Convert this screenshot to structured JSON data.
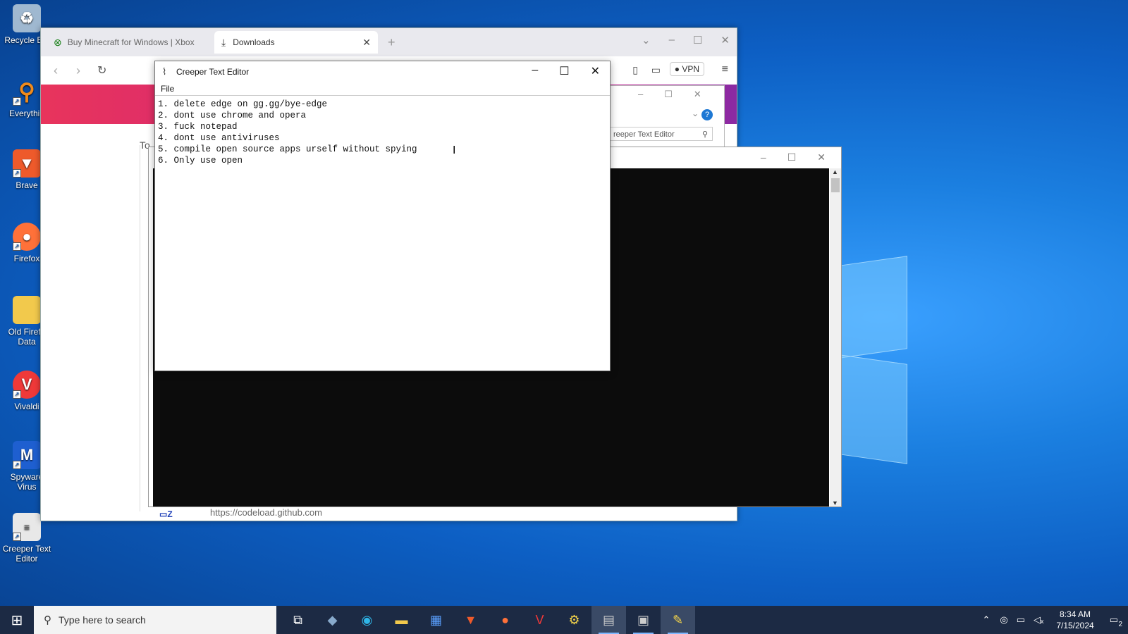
{
  "desktop": {
    "icons": [
      {
        "label": "Recycle Bin",
        "icon": "recycle-bin-icon",
        "color": "#9fb8d0"
      },
      {
        "label": "Everythin",
        "icon": "everything-icon",
        "color": "#f08a1c"
      },
      {
        "label": "Brave",
        "icon": "brave-icon",
        "color": "#ee5a2b"
      },
      {
        "label": "Firefox",
        "icon": "firefox-icon",
        "color": "#ff7139"
      },
      {
        "label": "Old Firefo Data",
        "icon": "folder-icon",
        "color": "#f2c94c"
      },
      {
        "label": "Vivaldi",
        "icon": "vivaldi-icon",
        "color": "#ef3939"
      },
      {
        "label": "Spyware Virus",
        "icon": "malwarebytes-icon",
        "color": "#1e5fd0"
      },
      {
        "label": "Creeper Text Editor",
        "icon": "text-file-icon",
        "color": "#e8e8e8"
      }
    ]
  },
  "browser": {
    "tabs": [
      {
        "label": "Buy Minecraft for Windows | Xbox",
        "icon": "xbox-icon",
        "active": false
      },
      {
        "label": "Downloads",
        "icon": "download-icon",
        "active": true
      }
    ],
    "vpn_label": "VPN",
    "bottom_url": "https://codeload.github.com",
    "partial_text": "To",
    "accent": "#e8345c"
  },
  "downloads_window": {
    "search_placeholder": "reeper Text Editor",
    "help_label": "?"
  },
  "editor": {
    "title": "Creeper Text Editor",
    "menu": [
      "File"
    ],
    "lines": [
      "1. delete edge on gg.gg/bye-edge",
      "2. dont use chrome and opera",
      "3. fuck notepad",
      "4. dont use antiviruses",
      "5. compile open source apps urself without spying",
      "6. Only use open"
    ]
  },
  "taskbar": {
    "search_placeholder": "Type here to search",
    "apps": [
      "task-view-icon",
      "copilot-icon",
      "edge-icon",
      "file-explorer-icon",
      "store-icon",
      "brave-icon",
      "firefox-icon",
      "vivaldi-icon",
      "python-icon",
      "app-icon",
      "app-icon-2",
      "python-idle-icon"
    ],
    "time": "8:34 AM",
    "date": "7/15/2024",
    "notification_count": "2"
  }
}
